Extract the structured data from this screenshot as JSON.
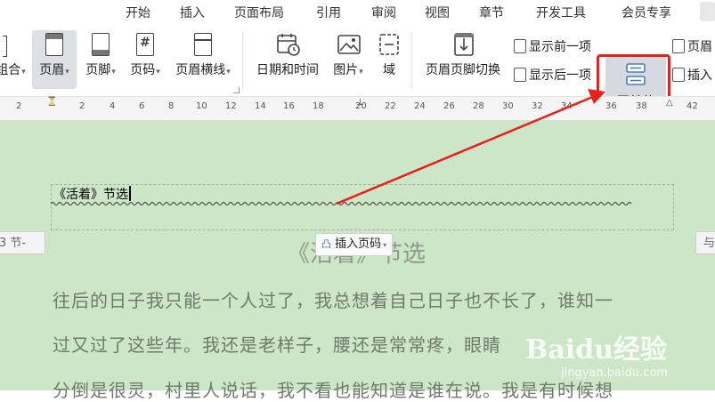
{
  "menu": {
    "items": [
      "开始",
      "插入",
      "页面布局",
      "引用",
      "审阅",
      "视图",
      "章节",
      "开发工具",
      "会员专享"
    ]
  },
  "ribbon": {
    "combine_label": "组合",
    "header_label": "页眉",
    "footer_label": "页脚",
    "page_number_label": "页码",
    "header_line_label": "页眉横线",
    "date_time_label": "日期和时间",
    "picture_label": "图片",
    "field_label": "域",
    "switch_label": "页眉页脚切换",
    "show_prev_label": "显示前一项",
    "show_next_label": "显示后一项",
    "same_as_prev_label": "同前节",
    "header_right_label": "页眉",
    "insert_right_label": "插入"
  },
  "ruler": {
    "numbers": [
      "2",
      "2",
      "4",
      "6",
      "8",
      "10",
      "12",
      "14",
      "16",
      "18",
      "20",
      "22",
      "24",
      "26",
      "28",
      "30",
      "32",
      "34",
      "36",
      "38",
      "42"
    ]
  },
  "document": {
    "header_text": "《活着》节选",
    "section_left": "3 节-",
    "section_right": "与",
    "insert_page_number": "插入页码",
    "title": "《活着》节选",
    "paragraph_lines": [
      "往后的日子我只能一个人过了，我总想着自己日子也不长了，谁知一",
      "过又过了这些年。我还是老样子，腰还是常常疼，眼睛",
      "分倒是很灵，村里人说话，我不看也能知道是谁在说。我是有时候想"
    ],
    "watermark_main": "Baidu经验",
    "watermark_sub": "jingyan.baidu.com"
  },
  "colors": {
    "document_bg": "#cde6c7",
    "highlight_box": "#e8211c",
    "arrow": "#e8211c"
  }
}
